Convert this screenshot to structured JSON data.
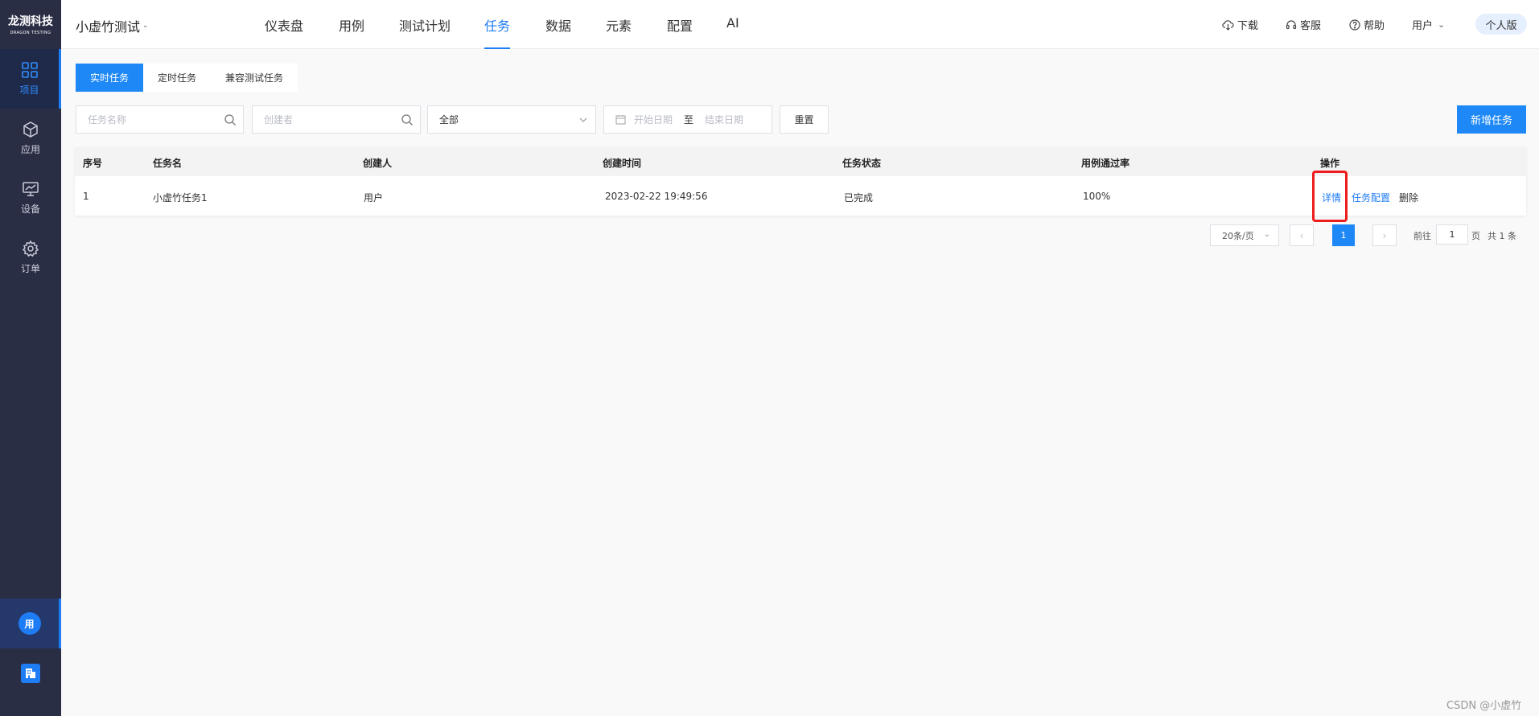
{
  "brand": {
    "name": "龙测科技",
    "sub": "DRAGON TESTING"
  },
  "sidebar": {
    "items": [
      {
        "label": "项目",
        "icon": "grid-icon",
        "active": true
      },
      {
        "label": "应用",
        "icon": "cube-icon",
        "active": false
      },
      {
        "label": "设备",
        "icon": "monitor-icon",
        "active": false
      },
      {
        "label": "订单",
        "icon": "gear-icon",
        "active": false
      }
    ],
    "user_avatar": "用",
    "org_icon": "building-icon"
  },
  "header": {
    "project": "小虚竹测试",
    "nav": [
      "仪表盘",
      "用例",
      "测试计划",
      "任务",
      "数据",
      "元素",
      "配置",
      "AI"
    ],
    "active_nav": "任务",
    "download": "下载",
    "support": "客服",
    "help": "帮助",
    "user": "用户",
    "plan": "个人版"
  },
  "tabs": [
    "实时任务",
    "定时任务",
    "兼容测试任务"
  ],
  "filters": {
    "task_name_placeholder": "任务名称",
    "creator_placeholder": "创建者",
    "status_value": "全部",
    "start_date_placeholder": "开始日期",
    "date_separator": "至",
    "end_date_placeholder": "结束日期",
    "reset": "重置",
    "new_task": "新增任务"
  },
  "table": {
    "headers": [
      "序号",
      "任务名",
      "创建人",
      "创建时间",
      "任务状态",
      "用例通过率",
      "操作"
    ],
    "rows": [
      {
        "index": "1",
        "name": "小虚竹任务1",
        "creator": "用户",
        "created": "2023-02-22 19:49:56",
        "status": "已完成",
        "pass_rate": "100%"
      }
    ],
    "actions": {
      "detail": "详情",
      "config": "任务配置",
      "delete": "删除"
    }
  },
  "pagination": {
    "page_size": "20条/页",
    "current": "1",
    "goto_prefix": "前往",
    "goto_value": "1",
    "goto_suffix": "页",
    "total": "共 1 条"
  },
  "watermark": "CSDN @小虚竹",
  "colors": {
    "primary": "#1e88f6",
    "sidebar": "#2a2e45",
    "highlight": "#ee1c1c"
  }
}
